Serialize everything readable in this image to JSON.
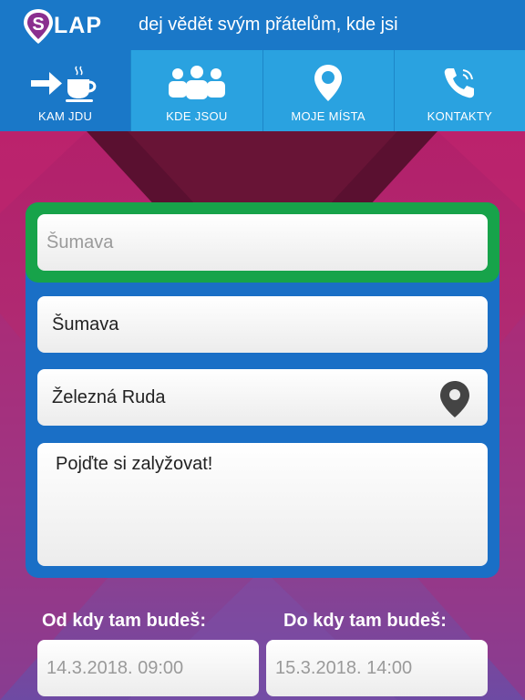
{
  "header": {
    "logo_text": "LAP",
    "tagline": "dej vědět svým přátelům, kde jsi"
  },
  "tabs": [
    {
      "label": "KAM JDU",
      "icon": "arrow-coffee-icon",
      "active": true
    },
    {
      "label": "KDE JSOU",
      "icon": "people-icon",
      "active": false
    },
    {
      "label": "MOJE MÍSTA",
      "icon": "location-pin-icon",
      "active": false
    },
    {
      "label": "KONTAKTY",
      "icon": "phone-icon",
      "active": false
    }
  ],
  "form": {
    "search_placeholder": "Šumava",
    "place_name": "Šumava",
    "location": "Železná Ruda",
    "note": "Pojďte si zalyžovat!",
    "from_label": "Od kdy tam budeš:",
    "from_value": "14.3.2018. 09:00",
    "to_label": "Do kdy tam budeš:",
    "to_value": "15.3.2018. 14:00"
  },
  "colors": {
    "header_blue": "#1a78c8",
    "tab_light_blue": "#2aa2e0",
    "search_border_green": "#17a34a",
    "panel_blue": "#1a6fc6",
    "background_magenta": "#b2296f"
  }
}
